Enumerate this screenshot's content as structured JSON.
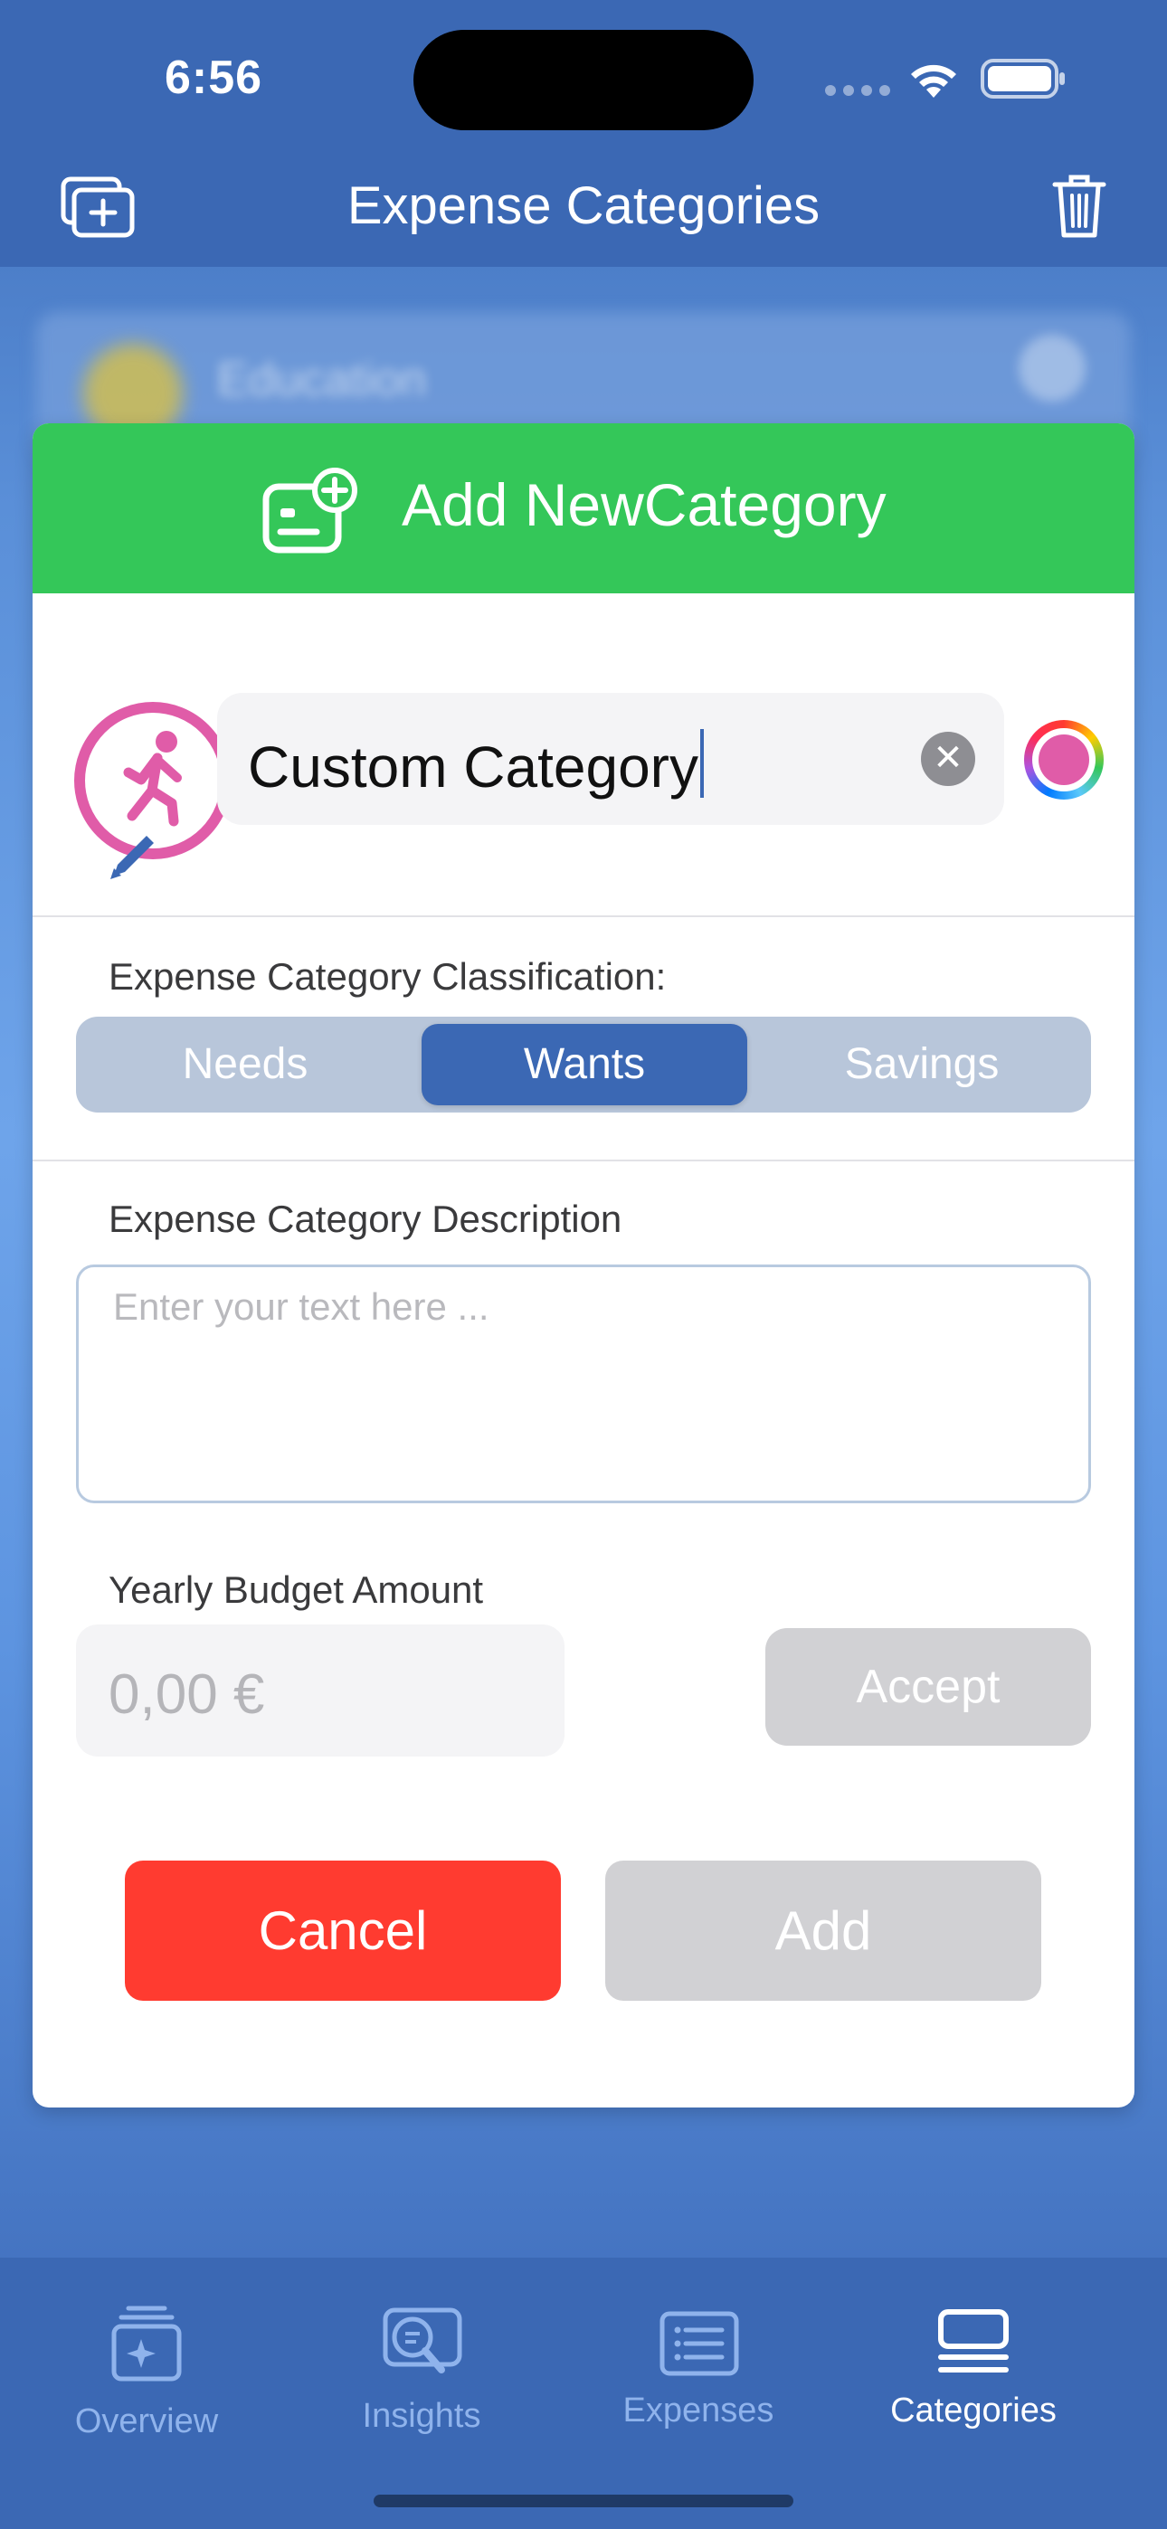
{
  "status": {
    "time": "6:56"
  },
  "nav": {
    "title": "Expense Categories"
  },
  "background_list": {
    "first_item": "Education"
  },
  "modal": {
    "title": "Add NewCategory",
    "name_value": "Custom Category",
    "classification_label": "Expense Category Classification:",
    "classification": {
      "options": [
        "Needs",
        "Wants",
        "Savings"
      ],
      "selected": "Wants"
    },
    "description_label": "Expense Category Description",
    "description_placeholder": "Enter your text here ...",
    "budget_label": "Yearly Budget Amount",
    "budget_placeholder": "0,00 €",
    "accept_label": "Accept",
    "cancel_label": "Cancel",
    "add_label": "Add",
    "colors": {
      "header": "#34c759",
      "category": "#e05ca8",
      "cancel": "#ff3b30",
      "accent": "#3b68b4"
    }
  },
  "tabs": [
    {
      "label": "Overview",
      "icon": "sparkle-stack-icon"
    },
    {
      "label": "Insights",
      "icon": "magnifier-chart-icon"
    },
    {
      "label": "Expenses",
      "icon": "list-card-icon"
    },
    {
      "label": "Categories",
      "icon": "stacked-list-icon",
      "active": true
    }
  ]
}
